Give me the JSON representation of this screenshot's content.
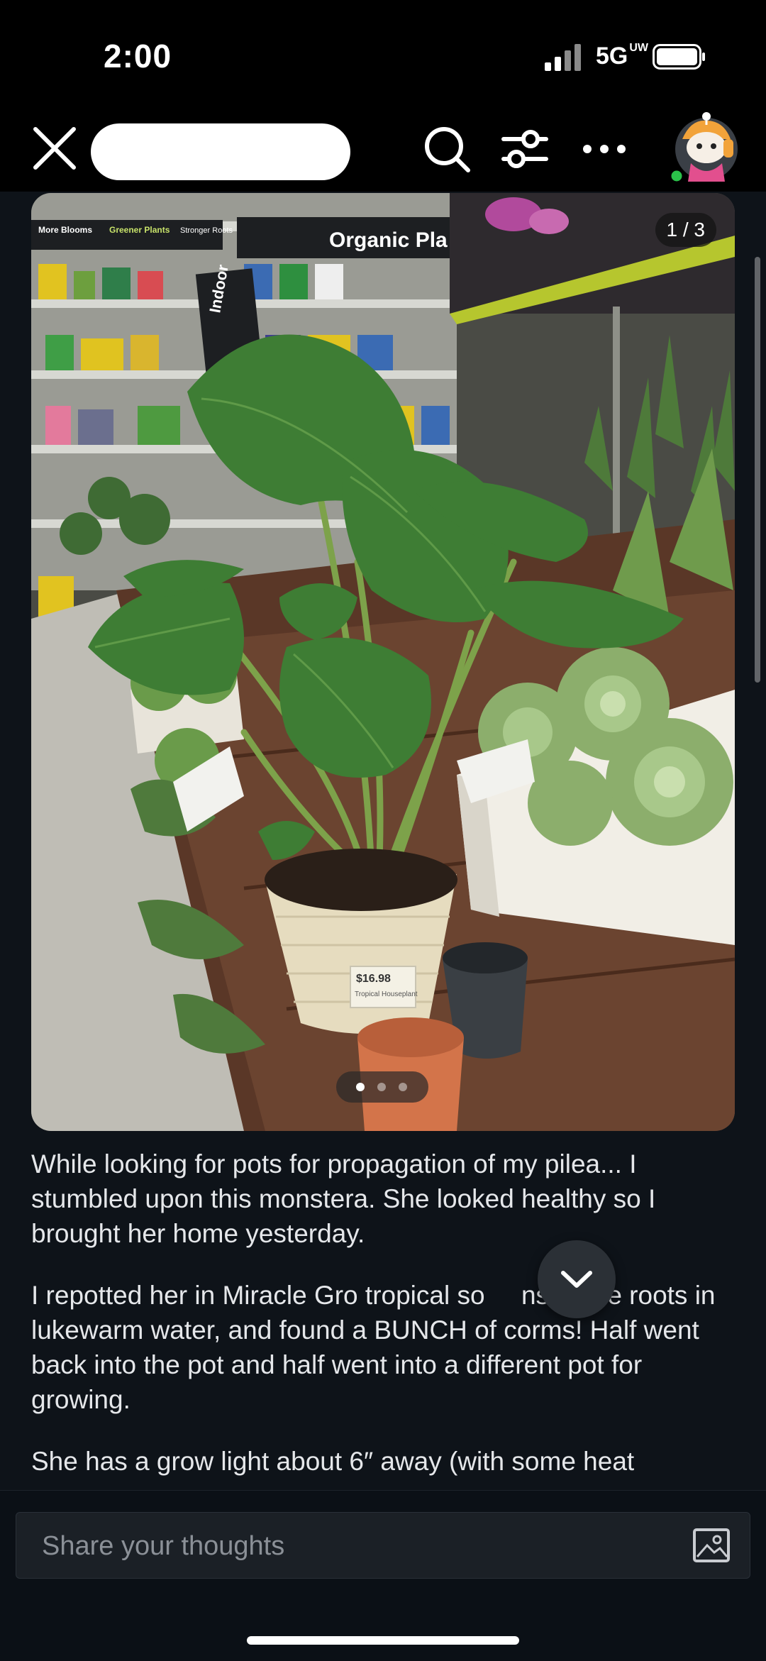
{
  "status": {
    "time": "2:00",
    "network": "5G",
    "network_sup": "UW"
  },
  "toolbar": {
    "icons": [
      "close-icon",
      "search-icon",
      "filter-icon",
      "more-icon",
      "avatar"
    ]
  },
  "post": {
    "image_counter": "1 / 3",
    "image_count": 3,
    "current_image": 1,
    "photo_labels": {
      "sign_left_1": "More Blooms",
      "sign_left_2": "Greener Plants",
      "sign_left_3": "Stronger Roots",
      "sign_center": "Organic Pla",
      "sign_indoor": "Indoor",
      "price_tag": "$16.98",
      "price_tag_2": "Tropical Houseplant"
    },
    "paragraphs": [
      "While looking for pots for propagation of my pilea... I stumbled upon this monstera. She looked healthy so I brought her home yesterday.",
      "I repotted her in Miracle Gro tropical so     nsed the roots in lukewarm water, and found a BUNCH of corms! Half went back into the pot and half went into a different pot for growing.",
      "She has a grow light about 6″ away (with some heat"
    ]
  },
  "composer": {
    "placeholder": "Share your thoughts"
  },
  "colors": {
    "background": "#0e1319",
    "text": "#e5e7ea",
    "placeholder": "#8b9097"
  }
}
